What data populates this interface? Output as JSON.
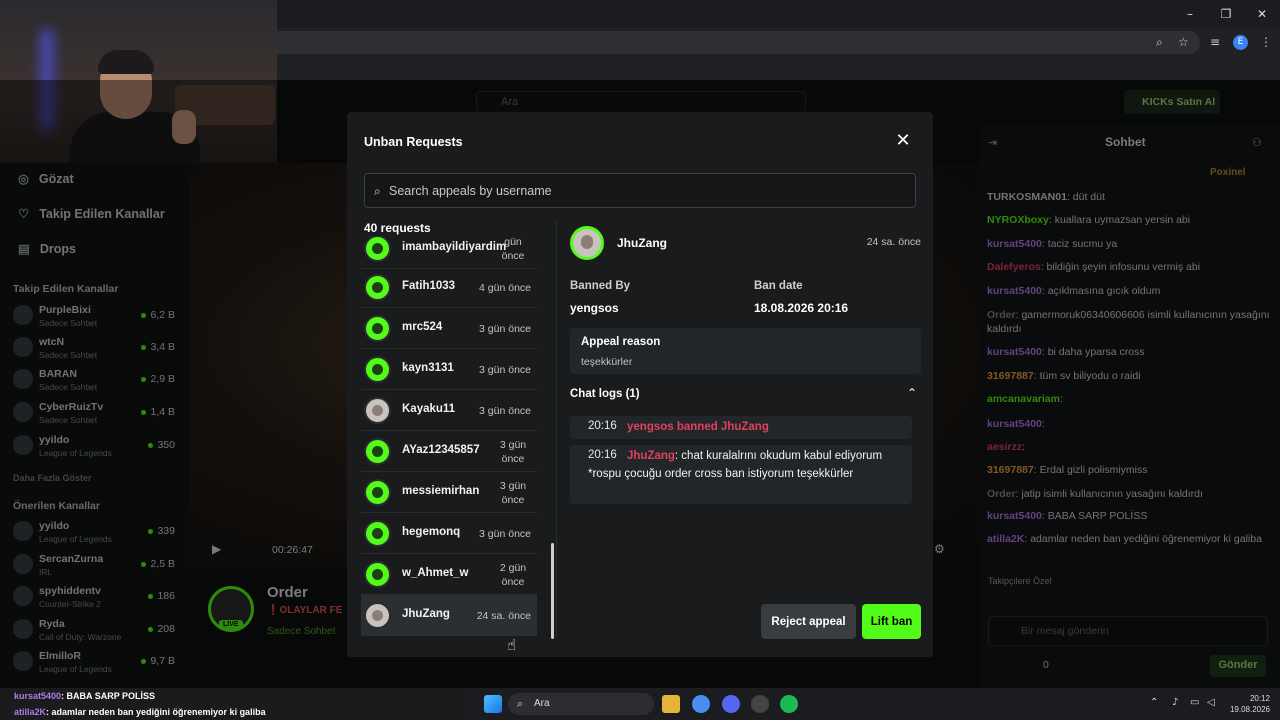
{
  "browser": {
    "window_controls": [
      "–",
      "❐",
      "✕"
    ],
    "profile_initial": "E"
  },
  "kick": {
    "search_placeholder": "Ara",
    "kicks_button": "KICKs Satın Al",
    "sidebar": {
      "nav": [
        {
          "icon": "compass-icon",
          "label": "Gözat"
        },
        {
          "icon": "heart-icon",
          "label": "Takip Edilen Kanallar"
        },
        {
          "icon": "gift-icon",
          "label": "Drops"
        }
      ],
      "followed_header": "Takip Edilen Kanallar",
      "followed": [
        {
          "name": "PurpleBixi",
          "category": "Sadece Sohbet",
          "viewers": "6,2 B"
        },
        {
          "name": "wtcN",
          "category": "Sadece Sohbet",
          "viewers": "3,4 B"
        },
        {
          "name": "BARAN",
          "category": "Sadece Sohbet",
          "viewers": "2,9 B"
        },
        {
          "name": "CyberRuizTv",
          "category": "Sadece Sohbet",
          "viewers": "1,4 B"
        },
        {
          "name": "yyildo",
          "category": "League of Legends",
          "viewers": "350"
        }
      ],
      "show_more": "Daha Fazla Göster",
      "recommended_header": "Önerilen Kanallar",
      "recommended": [
        {
          "name": "yyildo",
          "category": "League of Legends",
          "viewers": "339"
        },
        {
          "name": "SercanZurna",
          "category": "IRL",
          "viewers": "2,5 B"
        },
        {
          "name": "spyhiddentv",
          "category": "Counter-Strike 2",
          "viewers": "186"
        },
        {
          "name": "Ryda",
          "category": "Call of Duty: Warzone",
          "viewers": "208"
        },
        {
          "name": "ElmilloR",
          "category": "League of Legends",
          "viewers": "9,7 B"
        }
      ]
    },
    "video": {
      "elapsed": "00:26:47",
      "streamer": "Order",
      "title": "❗OLAYLAR FE",
      "category": "Sadece Sohbet",
      "live_badge": "LIVE"
    },
    "chat": {
      "title": "Sohbet",
      "pinned": "Poxinel",
      "messages": [
        {
          "user": "TURKOSMAN01",
          "text": "düt düt",
          "color": "#cfd3d5"
        },
        {
          "user": "NYROXboxy",
          "text": "kuallara uymazsan yersin abi",
          "color": "#53fc18"
        },
        {
          "user": "kursat5400",
          "text": "taciz sucmu ya",
          "color": "#b07be6"
        },
        {
          "user": "Dalefyeros",
          "text": "bildiğin şeyin infosunu vermiş abi",
          "color": "#e0415e"
        },
        {
          "user": "kursat5400",
          "text": "açıklmasına gıcık oldum",
          "color": "#b07be6"
        },
        {
          "user": "Order",
          "text": "gamermoruk06340606606 isimli kullanıcının yasağını kaldırdı",
          "color": "#888"
        },
        {
          "user": "kursat5400",
          "text": "bi daha yparsa cross",
          "color": "#b07be6"
        },
        {
          "user": "31697887",
          "text": "tüm sv biliyodu o raidi",
          "color": "#e8a23a"
        },
        {
          "user": "amcanavariam",
          "text": "",
          "color": "#53fc18"
        },
        {
          "user": "kursat5400",
          "text": "",
          "color": "#b07be6"
        },
        {
          "user": "aesirzz",
          "text": "",
          "color": "#e0415e"
        },
        {
          "user": "31697887",
          "text": "Erdal gizli polismiymiss",
          "color": "#e8a23a"
        },
        {
          "user": "Order",
          "text": "jatip isimli kullanıcının yasağını kaldırdı",
          "color": "#888"
        },
        {
          "user": "kursat5400",
          "text": "BABA SARP POLİSS",
          "color": "#b07be6"
        },
        {
          "user": "atilla2K",
          "text": "adamlar neden ban yediğini öğrenemiyor ki galiba",
          "color": "#b07be6"
        }
      ],
      "emote_header": "Takipçilere Özel",
      "input_placeholder": "Bir mesaj gönderin",
      "send_label": "Gönder",
      "count": "0"
    }
  },
  "modal": {
    "title": "Unban Requests",
    "search_placeholder": "Search appeals by username",
    "count_label": "40 requests",
    "requests": [
      {
        "name": "imambayildiyardim",
        "time": "gün önce",
        "two_line": true
      },
      {
        "name": "Fatih1033",
        "time": "4 gün önce"
      },
      {
        "name": "mrc524",
        "time": "3 gün önce"
      },
      {
        "name": "kayn3131",
        "time": "3 gün önce"
      },
      {
        "name": "Kayaku11",
        "time": "3 gün önce",
        "gray": true
      },
      {
        "name": "AYaz12345857",
        "time": "3 gün önce",
        "two_line": true
      },
      {
        "name": "messiemirhan",
        "time": "3 gün önce",
        "two_line": true
      },
      {
        "name": "hegemonq",
        "time": "3 gün önce"
      },
      {
        "name": "w_Ahmet_w",
        "time": "2 gün önce",
        "two_line": true
      },
      {
        "name": "JhuZang",
        "time": "24 sa. önce",
        "selected": true
      }
    ],
    "detail": {
      "username": "JhuZang",
      "time": "24 sa. önce",
      "banned_by_label": "Banned By",
      "banned_by": "yengsos",
      "ban_date_label": "Ban date",
      "ban_date": "18.08.2026 20:16",
      "appeal_reason_label": "Appeal reason",
      "appeal_reason": "teşekkürler",
      "chat_logs_label": "Chat logs (1)",
      "logs": [
        {
          "time": "20:16",
          "event": "yengsos banned JhuZang"
        },
        {
          "time": "20:16",
          "user": "JhuZang",
          "message": ": chat kuralalrını okudum kabul ediyorum *rospu çocuğu order cross ban istiyorum teşekkürler"
        }
      ],
      "reject_label": "Reject appeal",
      "lift_label": "Lift ban"
    }
  },
  "overlay_chat": [
    {
      "user": "kursat5400",
      "text": ": BABA SARP POLİSS"
    },
    {
      "user": "atilla2K",
      "text": ": adamlar neden ban yediğini öğrenemiyor ki galiba"
    }
  ],
  "taskbar": {
    "search_placeholder": "Ara",
    "time": "20:12",
    "date": "19.08.2026"
  }
}
